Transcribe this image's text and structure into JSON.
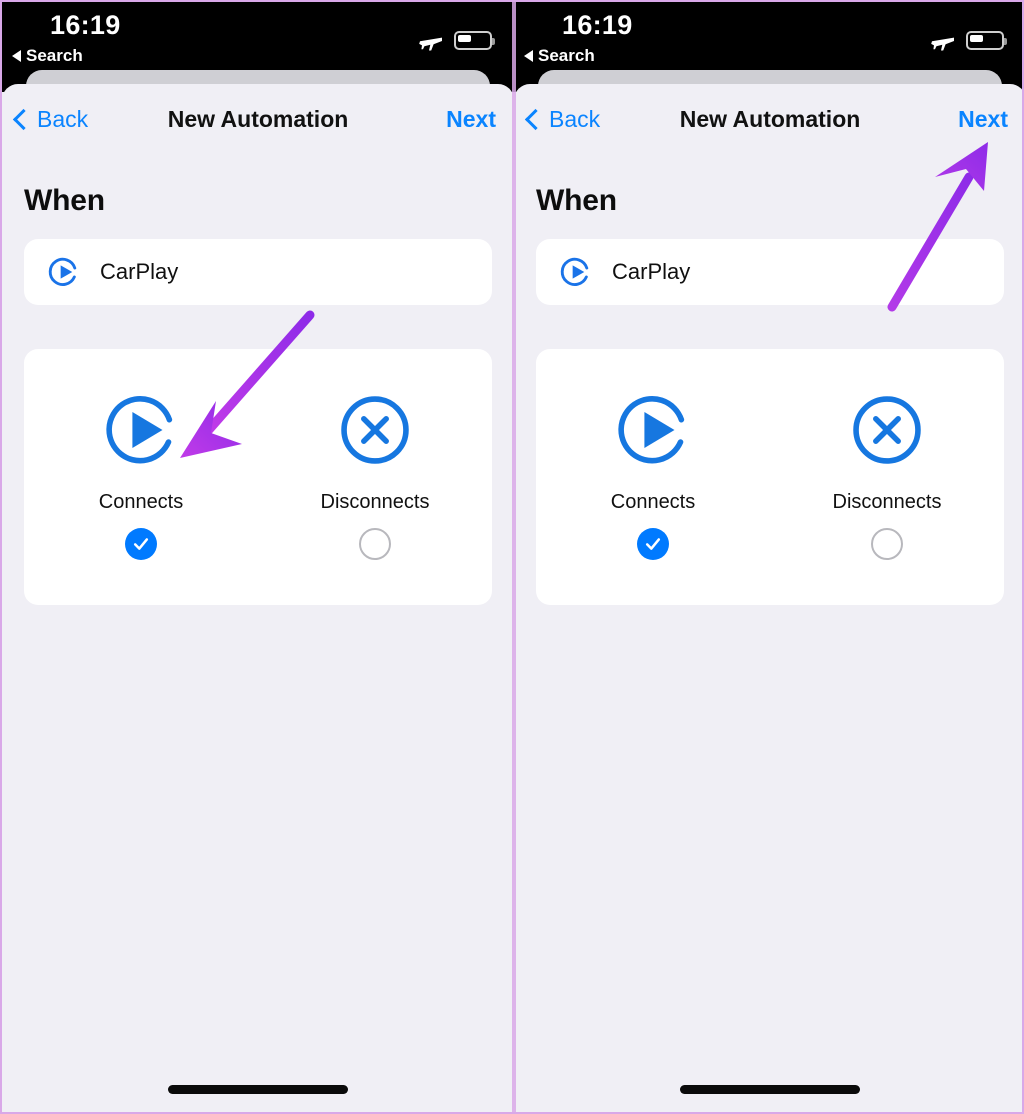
{
  "meta": {
    "accent_blue": "#007AFF",
    "nav_blue": "#0A84FF",
    "annotation_purple": "#A62CE8",
    "background": "#F0EFF5",
    "card_background": "#FFFFFF",
    "status_bar_background": "#000000",
    "frame_border": "#D9A8E8"
  },
  "status_bar": {
    "time": "16:19",
    "back_to_app_label": "Search",
    "back_triangle_icon": "triangle-left-icon",
    "airplane_mode_icon": "airplane-icon",
    "battery_icon": "battery-icon",
    "battery_level_percent": 38
  },
  "nav": {
    "back_label": "Back",
    "back_icon": "chevron-left-icon",
    "title": "New Automation",
    "next_label": "Next"
  },
  "content": {
    "section_heading": "When",
    "trigger": {
      "label": "CarPlay",
      "icon": "carplay-play-circle-icon"
    },
    "options": [
      {
        "label": "Connects",
        "icon": "play-circle-open-icon",
        "selected": true,
        "radio_icon": "check-circle-filled-icon"
      },
      {
        "label": "Disconnects",
        "icon": "x-circle-icon",
        "selected": false,
        "radio_icon": "circle-empty-icon"
      }
    ]
  },
  "annotations": {
    "left_arrow": {
      "name": "arrow-pointing-to-connects-icon",
      "points_to": "Connects"
    },
    "right_arrow": {
      "name": "arrow-pointing-to-next-button",
      "points_to": "Next"
    }
  }
}
